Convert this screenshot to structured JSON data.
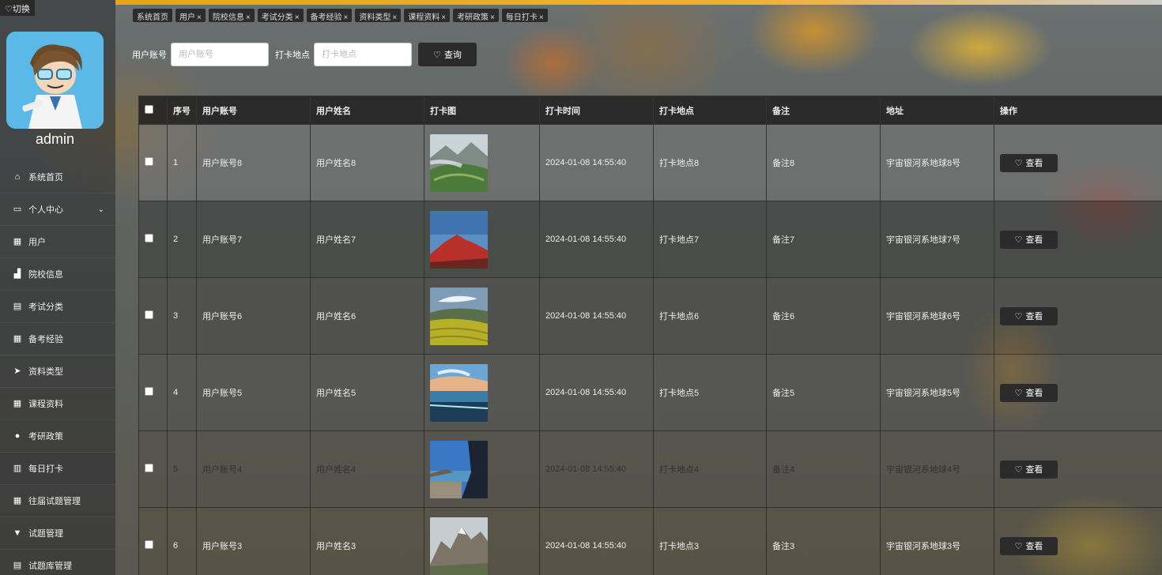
{
  "header": {
    "switch_label": "切换"
  },
  "user": {
    "name": "admin"
  },
  "sidebar": {
    "items": [
      {
        "label": "系统首页",
        "icon": "home-icon",
        "glyph": "⌂"
      },
      {
        "label": "个人中心",
        "icon": "id-card-icon",
        "glyph": "▭",
        "has_chevron": true
      },
      {
        "label": "用户",
        "icon": "grid-icon",
        "glyph": "▦"
      },
      {
        "label": "院校信息",
        "icon": "building-icon",
        "glyph": "▟"
      },
      {
        "label": "考试分类",
        "icon": "clipboard-icon",
        "glyph": "▤"
      },
      {
        "label": "备考经验",
        "icon": "grid-icon",
        "glyph": "▦"
      },
      {
        "label": "资料类型",
        "icon": "send-icon",
        "glyph": "➤"
      },
      {
        "label": "课程资料",
        "icon": "grid-icon",
        "glyph": "▦"
      },
      {
        "label": "考研政策",
        "icon": "user-icon",
        "glyph": "●"
      },
      {
        "label": "每日打卡",
        "icon": "chart-icon",
        "glyph": "▥",
        "active": true
      },
      {
        "label": "往届试题管理",
        "icon": "grid-icon",
        "glyph": "▦"
      },
      {
        "label": "试题管理",
        "icon": "trophy-icon",
        "glyph": "▼"
      },
      {
        "label": "试题库管理",
        "icon": "clipboard-icon",
        "glyph": "▤"
      }
    ]
  },
  "tabs": [
    {
      "label": "系统首页",
      "closable": false
    },
    {
      "label": "用户",
      "closable": true
    },
    {
      "label": "院校信息",
      "closable": true
    },
    {
      "label": "考试分类",
      "closable": true
    },
    {
      "label": "备考经验",
      "closable": true
    },
    {
      "label": "资料类型",
      "closable": true
    },
    {
      "label": "课程资料",
      "closable": true
    },
    {
      "label": "考研政策",
      "closable": true
    },
    {
      "label": "每日打卡",
      "closable": true
    }
  ],
  "tab_close_glyph": "×",
  "search": {
    "account_label": "用户账号",
    "account_placeholder": "用户账号",
    "location_label": "打卡地点",
    "location_placeholder": "打卡地点",
    "query_label": "查询"
  },
  "table": {
    "columns": [
      "序号",
      "用户账号",
      "用户姓名",
      "打卡图",
      "打卡时间",
      "打卡地点",
      "备注",
      "地址",
      "操作"
    ],
    "view_label": "查看",
    "rows": [
      {
        "index": "1",
        "account": "用户账号8",
        "name": "用户姓名8",
        "image": "mountain-terraces",
        "time": "2024-01-08 14:55:40",
        "location": "打卡地点8",
        "note": "备注8",
        "address": "宇宙银河系地球8号"
      },
      {
        "index": "2",
        "account": "用户账号7",
        "name": "用户姓名7",
        "image": "red-peak",
        "time": "2024-01-08 14:55:40",
        "location": "打卡地点7",
        "note": "备注7",
        "address": "宇宙银河系地球7号"
      },
      {
        "index": "3",
        "account": "用户账号6",
        "name": "用户姓名6",
        "image": "rice-terraces",
        "time": "2024-01-08 14:55:40",
        "location": "打卡地点6",
        "note": "备注6",
        "address": "宇宙银河系地球6号"
      },
      {
        "index": "4",
        "account": "用户账号5",
        "name": "用户姓名5",
        "image": "seaside-sunset",
        "time": "2024-01-08 14:55:40",
        "location": "打卡地点5",
        "note": "备注5",
        "address": "宇宙银河系地球5号"
      },
      {
        "index": "5",
        "account": "用户账号4",
        "name": "用户姓名4",
        "image": "coast-cliff",
        "time": "2024-01-08 14:55:40",
        "location": "打卡地点4",
        "note": "备注4",
        "address": "宇宙银河系地球4号"
      },
      {
        "index": "6",
        "account": "用户账号3",
        "name": "用户姓名3",
        "image": "rocky-mountain",
        "time": "2024-01-08 14:55:40",
        "location": "打卡地点3",
        "note": "备注3",
        "address": "宇宙银河系地球3号"
      }
    ]
  }
}
